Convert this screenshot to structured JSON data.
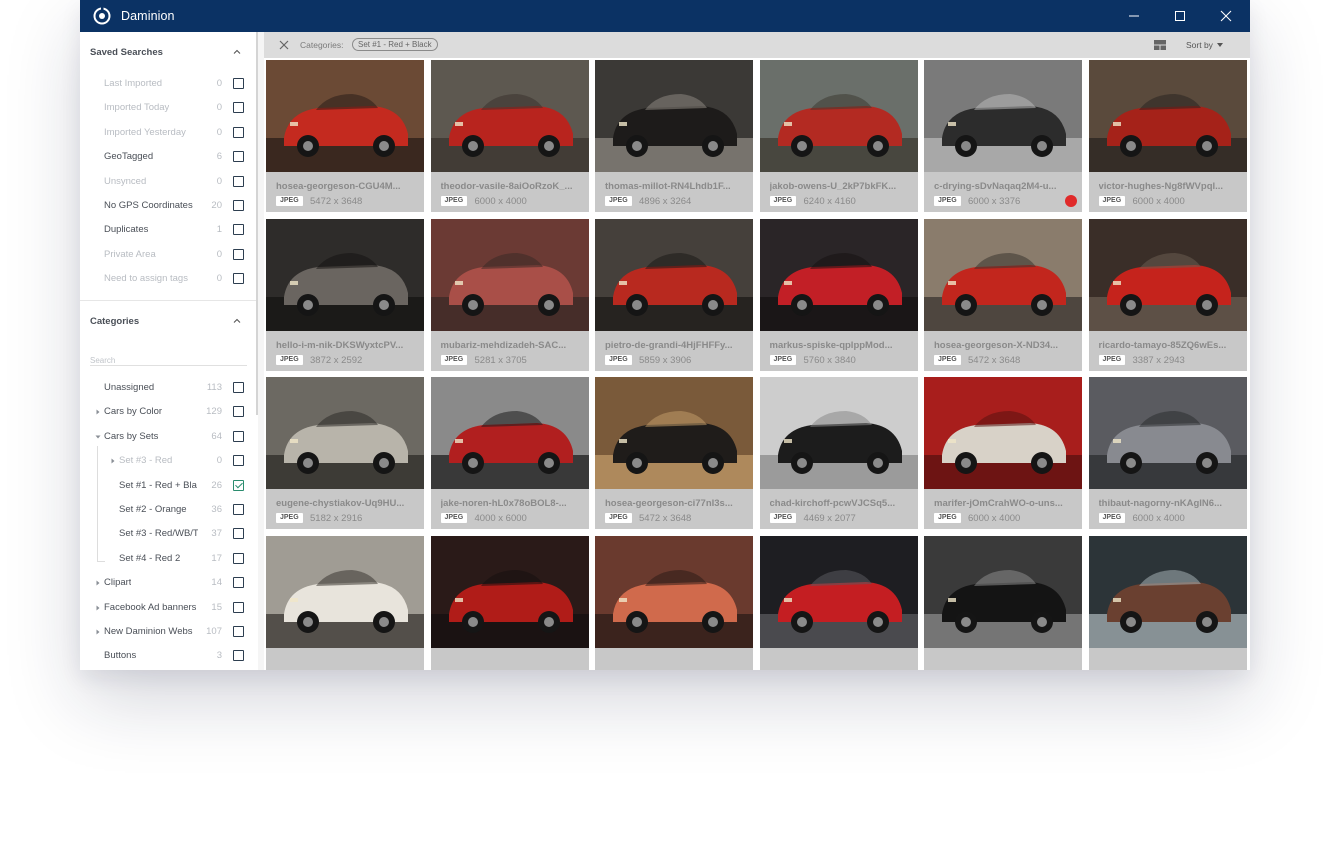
{
  "app": {
    "title": "Daminion"
  },
  "colors": {
    "titlebar": "#0b3264",
    "accent_check": "#2a8c6e",
    "red_label": "#e02a2a"
  },
  "sidebar": {
    "saved_searches": {
      "title": "Saved Searches",
      "items": [
        {
          "label": "Last Imported",
          "count": "0",
          "muted": true
        },
        {
          "label": "Imported Today",
          "count": "0",
          "muted": true
        },
        {
          "label": "Imported Yesterday",
          "count": "0",
          "muted": true
        },
        {
          "label": "GeoTagged",
          "count": "6",
          "muted": false
        },
        {
          "label": "Unsynced",
          "count": "0",
          "muted": true
        },
        {
          "label": "No GPS Coordinates",
          "count": "20",
          "muted": false
        },
        {
          "label": "Duplicates",
          "count": "1",
          "muted": false
        },
        {
          "label": "Private Area",
          "count": "0",
          "muted": true
        },
        {
          "label": "Need to assign tags",
          "count": "0",
          "muted": true
        }
      ]
    },
    "categories": {
      "title": "Categories",
      "search_placeholder": "Search",
      "items": [
        {
          "label": "Unassigned",
          "count": "113",
          "muted": false,
          "caret": "none",
          "checked": false
        },
        {
          "label": "Cars by Color",
          "count": "129",
          "muted": false,
          "caret": "right",
          "checked": false
        },
        {
          "label": "Cars by Sets",
          "count": "64",
          "muted": false,
          "caret": "down",
          "checked": false
        },
        {
          "label": "Set #3 - Red",
          "count": "0",
          "muted": true,
          "caret": "right",
          "checked": false
        },
        {
          "label": "Set #1 - Red + Bla",
          "count": "26",
          "muted": false,
          "caret": "none",
          "checked": true
        },
        {
          "label": "Set #2 - Orange",
          "count": "36",
          "muted": false,
          "caret": "none",
          "checked": false
        },
        {
          "label": "Set #3 - Red/WB/T",
          "count": "37",
          "muted": false,
          "caret": "none",
          "checked": false
        },
        {
          "label": "Set #4 - Red 2",
          "count": "17",
          "muted": false,
          "caret": "none",
          "checked": false
        },
        {
          "label": "Clipart",
          "count": "14",
          "muted": false,
          "caret": "right",
          "checked": false
        },
        {
          "label": "Facebook Ad banners",
          "count": "15",
          "muted": false,
          "caret": "right",
          "checked": false
        },
        {
          "label": "New Daminion Webs",
          "count": "107",
          "muted": false,
          "caret": "right",
          "checked": false
        },
        {
          "label": "Buttons",
          "count": "3",
          "muted": false,
          "caret": "none",
          "checked": false
        }
      ]
    }
  },
  "filter_bar": {
    "label": "Categories:",
    "chip": "Set #1 - Red + Black",
    "sort_label": "Sort by"
  },
  "grid": {
    "items": [
      {
        "name": "hosea-georgeson-CGU4M...",
        "format": "JPEG",
        "dims": "5472 x 3648",
        "red_label": false
      },
      {
        "name": "theodor-vasile-8aiOoRzoK_...",
        "format": "JPEG",
        "dims": "6000 x 4000",
        "red_label": false
      },
      {
        "name": "thomas-millot-RN4Lhdb1F...",
        "format": "JPEG",
        "dims": "4896 x 3264",
        "red_label": false
      },
      {
        "name": "jakob-owens-U_2kP7bkFK...",
        "format": "JPEG",
        "dims": "6240 x 4160",
        "red_label": false
      },
      {
        "name": "c-drying-sDvNaqaq2M4-u...",
        "format": "JPEG",
        "dims": "6000 x 3376",
        "red_label": true
      },
      {
        "name": "victor-hughes-Ng8fWVpql...",
        "format": "JPEG",
        "dims": "6000 x 4000",
        "red_label": false
      },
      {
        "name": "hello-i-m-nik-DKSWyxtcPV...",
        "format": "JPEG",
        "dims": "3872 x 2592",
        "red_label": false
      },
      {
        "name": "mubariz-mehdizadeh-SAC...",
        "format": "JPEG",
        "dims": "5281 x 3705",
        "red_label": false
      },
      {
        "name": "pietro-de-grandi-4HjFHFFy...",
        "format": "JPEG",
        "dims": "5859 x 3906",
        "red_label": false
      },
      {
        "name": "markus-spiske-qplppMod...",
        "format": "JPEG",
        "dims": "5760 x 3840",
        "red_label": false
      },
      {
        "name": "hosea-georgeson-X-ND34...",
        "format": "JPEG",
        "dims": "5472 x 3648",
        "red_label": false
      },
      {
        "name": "ricardo-tamayo-85ZQ6wEs...",
        "format": "JPEG",
        "dims": "3387 x 2943",
        "red_label": false
      },
      {
        "name": "eugene-chystiakov-Uq9HU...",
        "format": "JPEG",
        "dims": "5182 x 2916",
        "red_label": false
      },
      {
        "name": "jake-noren-hL0x78oBOL8-...",
        "format": "JPEG",
        "dims": "4000 x 6000",
        "red_label": false
      },
      {
        "name": "hosea-georgeson-ci77nI3s...",
        "format": "JPEG",
        "dims": "5472 x 3648",
        "red_label": false
      },
      {
        "name": "chad-kirchoff-pcwVJCSq5...",
        "format": "JPEG",
        "dims": "4469 x 2077",
        "red_label": false
      },
      {
        "name": "marifer-jOmCrahWO-o-uns...",
        "format": "JPEG",
        "dims": "6000 x 4000",
        "red_label": false
      },
      {
        "name": "thibaut-nagorny-nKAglN6...",
        "format": "JPEG",
        "dims": "6000 x 4000",
        "red_label": false
      },
      {
        "name": "",
        "format": "",
        "dims": "",
        "red_label": false
      },
      {
        "name": "",
        "format": "",
        "dims": "",
        "red_label": false
      },
      {
        "name": "",
        "format": "",
        "dims": "",
        "red_label": false
      },
      {
        "name": "",
        "format": "",
        "dims": "",
        "red_label": false
      },
      {
        "name": "",
        "format": "",
        "dims": "",
        "red_label": false
      },
      {
        "name": "",
        "format": "",
        "dims": "",
        "red_label": false
      }
    ]
  }
}
